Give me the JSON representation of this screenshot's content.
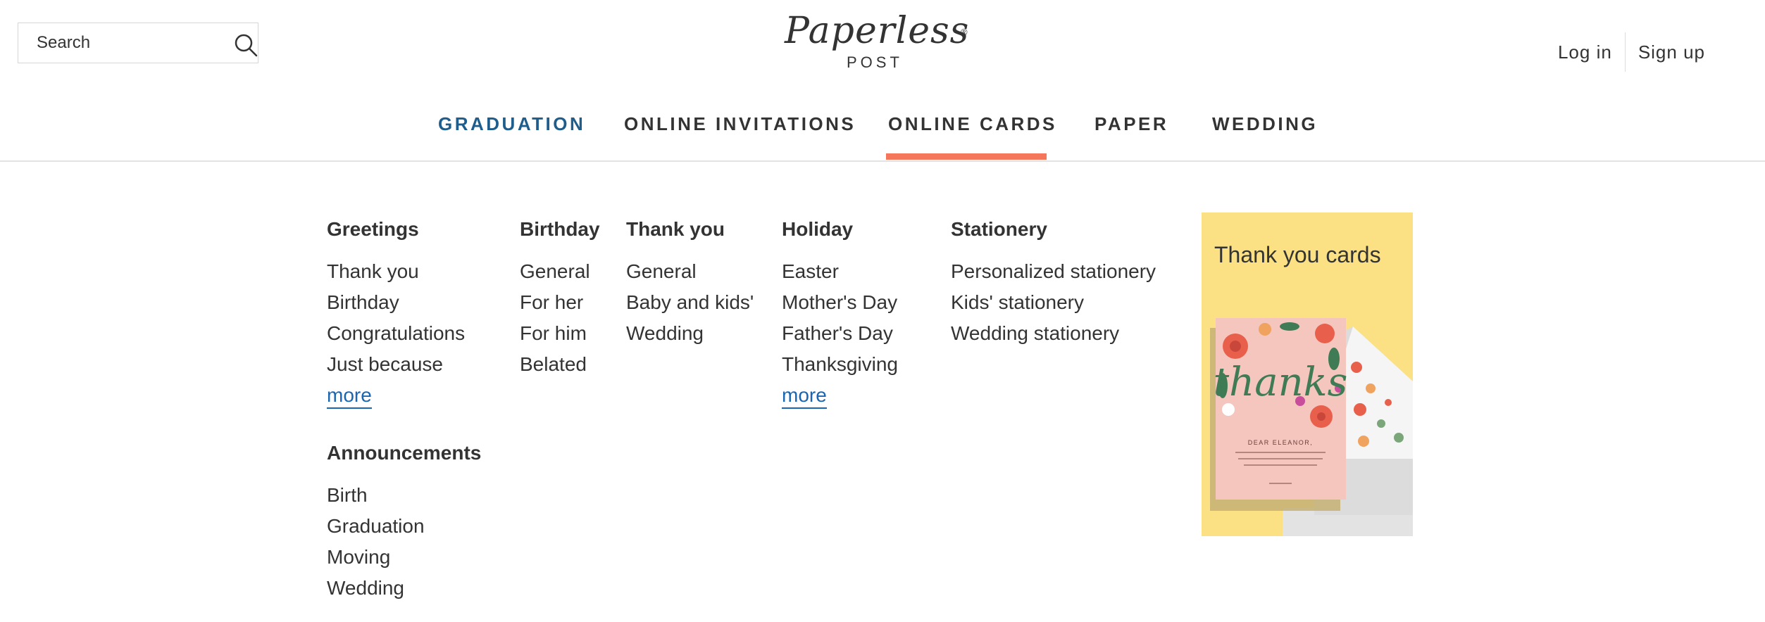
{
  "search": {
    "placeholder": "Search"
  },
  "brand": {
    "script": "Paperless",
    "sub": "POST",
    "reg": "®"
  },
  "auth": {
    "login": "Log in",
    "signup": "Sign up"
  },
  "nav": {
    "items": [
      {
        "label": "GRADUATION"
      },
      {
        "label": "ONLINE INVITATIONS"
      },
      {
        "label": "ONLINE CARDS"
      },
      {
        "label": "PAPER"
      },
      {
        "label": "WEDDING"
      }
    ],
    "active": "ONLINE CARDS",
    "colors": {
      "graduation": "#1f5d8c",
      "underline": "#f4775c"
    }
  },
  "menu": {
    "greetings": {
      "title": "Greetings",
      "items": [
        "Thank you",
        "Birthday",
        "Congratulations",
        "Just because"
      ],
      "more": "more"
    },
    "announcements": {
      "title": "Announcements",
      "items": [
        "Birth",
        "Graduation",
        "Moving",
        "Wedding"
      ]
    },
    "birthday": {
      "title": "Birthday",
      "items": [
        "General",
        "For her",
        "For him",
        "Belated"
      ]
    },
    "thankyou": {
      "title": "Thank you",
      "items": [
        "General",
        "Baby and kids'",
        "Wedding"
      ]
    },
    "holiday": {
      "title": "Holiday",
      "items": [
        "Easter",
        "Mother's Day",
        "Father's Day",
        "Thanksgiving"
      ],
      "more": "more"
    },
    "stationery": {
      "title": "Stationery",
      "items": [
        "Personalized stationery",
        "Kids' stationery",
        "Wedding stationery"
      ]
    }
  },
  "promo": {
    "title": "Thank you cards",
    "card_script": "thanks",
    "card_greeting": "DEAR ELEANOR,",
    "background": "#fbe184"
  }
}
